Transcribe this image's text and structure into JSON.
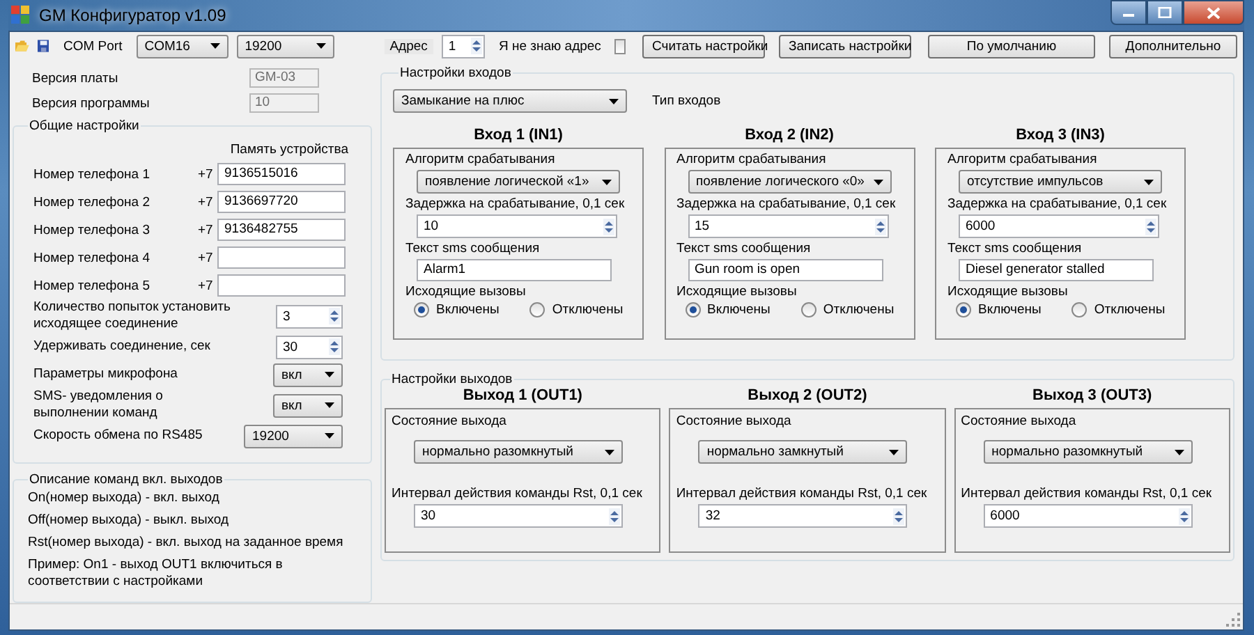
{
  "window": {
    "title": "GM Конфигуратор v1.09"
  },
  "toolbar": {
    "com_port_label": "COM Port",
    "port": "COM16",
    "baud": "19200",
    "address_label": "Адрес",
    "address": "1",
    "unknown_address": {
      "label": "Я не знаю адрес",
      "checked": false
    },
    "buttons": [
      "Считать настройки",
      "Записать настройки",
      "По умолчанию",
      "Дополнительно"
    ]
  },
  "versions": [
    {
      "label": "Версия платы",
      "value": "GM-03",
      "disabled": true
    },
    {
      "label": "Версия программы",
      "value": "10",
      "disabled": true
    }
  ],
  "general": {
    "title": "Общие настройки",
    "memory_header": "Память устройства",
    "phones": [
      {
        "label": "Номер телефона 1",
        "prefix": "+7",
        "value": "9136515016"
      },
      {
        "label": "Номер телефона 2",
        "prefix": "+7",
        "value": "9136697720"
      },
      {
        "label": "Номер телефона 3",
        "prefix": "+7",
        "value": "9136482755"
      },
      {
        "label": "Номер телефона 4",
        "prefix": "+7"
      },
      {
        "label": "Номер телефона 5",
        "prefix": "+7"
      }
    ],
    "settings": [
      {
        "kind": "spin",
        "label": "Количество попыток установить исходящее соединение",
        "value": "3"
      },
      {
        "kind": "spin",
        "label": "Удерживать соединение, сек",
        "value": "30"
      },
      {
        "kind": "select",
        "label": "Параметры микрофона",
        "value": "вкл"
      },
      {
        "kind": "select",
        "label": "SMS- уведомления о выполнении команд",
        "value": "вкл"
      },
      {
        "kind": "wide-select",
        "label": "Скорость обмена по  RS485",
        "value": "19200"
      }
    ]
  },
  "commands": {
    "title": "Описание команд вкл. выходов",
    "lines": [
      "On(номер выхода) - вкл. выход",
      "Off(номер выхода) - выкл. выход",
      "Rst(номер выхода) - вкл. выход на заданное время",
      "Пример: On1 - выход OUT1 включиться в соответствии с настройками"
    ]
  },
  "inputs": {
    "title": "Настройки входов",
    "type_select": "Замыкание на плюс",
    "type_label": "Тип входов",
    "items": [
      {
        "title": "Вход 1 (IN1)",
        "algorithm_label": "Алгоритм срабатывания",
        "algorithm": "появление логической «1»",
        "delay_label": "Задержка на срабатывание, 0,1 сек",
        "delay": "10",
        "sms_label": "Текст sms сообщения",
        "sms": "Alarm1",
        "calls_label": "Исходящие вызовы",
        "options": [
          {
            "label": "Включены",
            "selected": true
          },
          {
            "label": "Отключены",
            "selected": false
          }
        ]
      },
      {
        "title": "Вход 2 (IN2)",
        "algorithm_label": "Алгоритм срабатывания",
        "algorithm": "появление логического «0»",
        "delay_label": "Задержка на срабатывание, 0,1 сек",
        "delay": "15",
        "sms_label": "Текст sms сообщения",
        "sms": "Gun room is open",
        "calls_label": "Исходящие вызовы",
        "options": [
          {
            "label": "Включены",
            "selected": true
          },
          {
            "label": "Отключены",
            "selected": false
          }
        ]
      },
      {
        "title": "Вход 3 (IN3)",
        "algorithm_label": "Алгоритм срабатывания",
        "algorithm": "отсутствие импульсов",
        "delay_label": "Задержка на срабатывание, 0,1 сек",
        "delay": "6000",
        "sms_label": "Текст sms сообщения",
        "sms": "Diesel generator stalled",
        "calls_label": "Исходящие вызовы",
        "options": [
          {
            "label": "Включены",
            "selected": true
          },
          {
            "label": "Отключены",
            "selected": false
          }
        ]
      }
    ]
  },
  "outputs": {
    "title": "Настройки выходов",
    "items": [
      {
        "title": "Выход 1 (OUT1)",
        "state_label": "Состояние выхода",
        "state": "нормально разомкнутый",
        "interval_label": "Интервал действия команды Rst, 0,1 сек",
        "interval": "30"
      },
      {
        "title": "Выход 2 (OUT2)",
        "state_label": "Состояние выхода",
        "state": "нормально замкнутый",
        "interval_label": "Интервал действия команды Rst, 0,1 сек",
        "interval": "32"
      },
      {
        "title": "Выход 3 (OUT3)",
        "state_label": "Состояние выхода",
        "state": "нормально разомкнутый",
        "interval_label": "Интервал действия команды Rst, 0,1 сек",
        "interval": "6000"
      }
    ]
  }
}
